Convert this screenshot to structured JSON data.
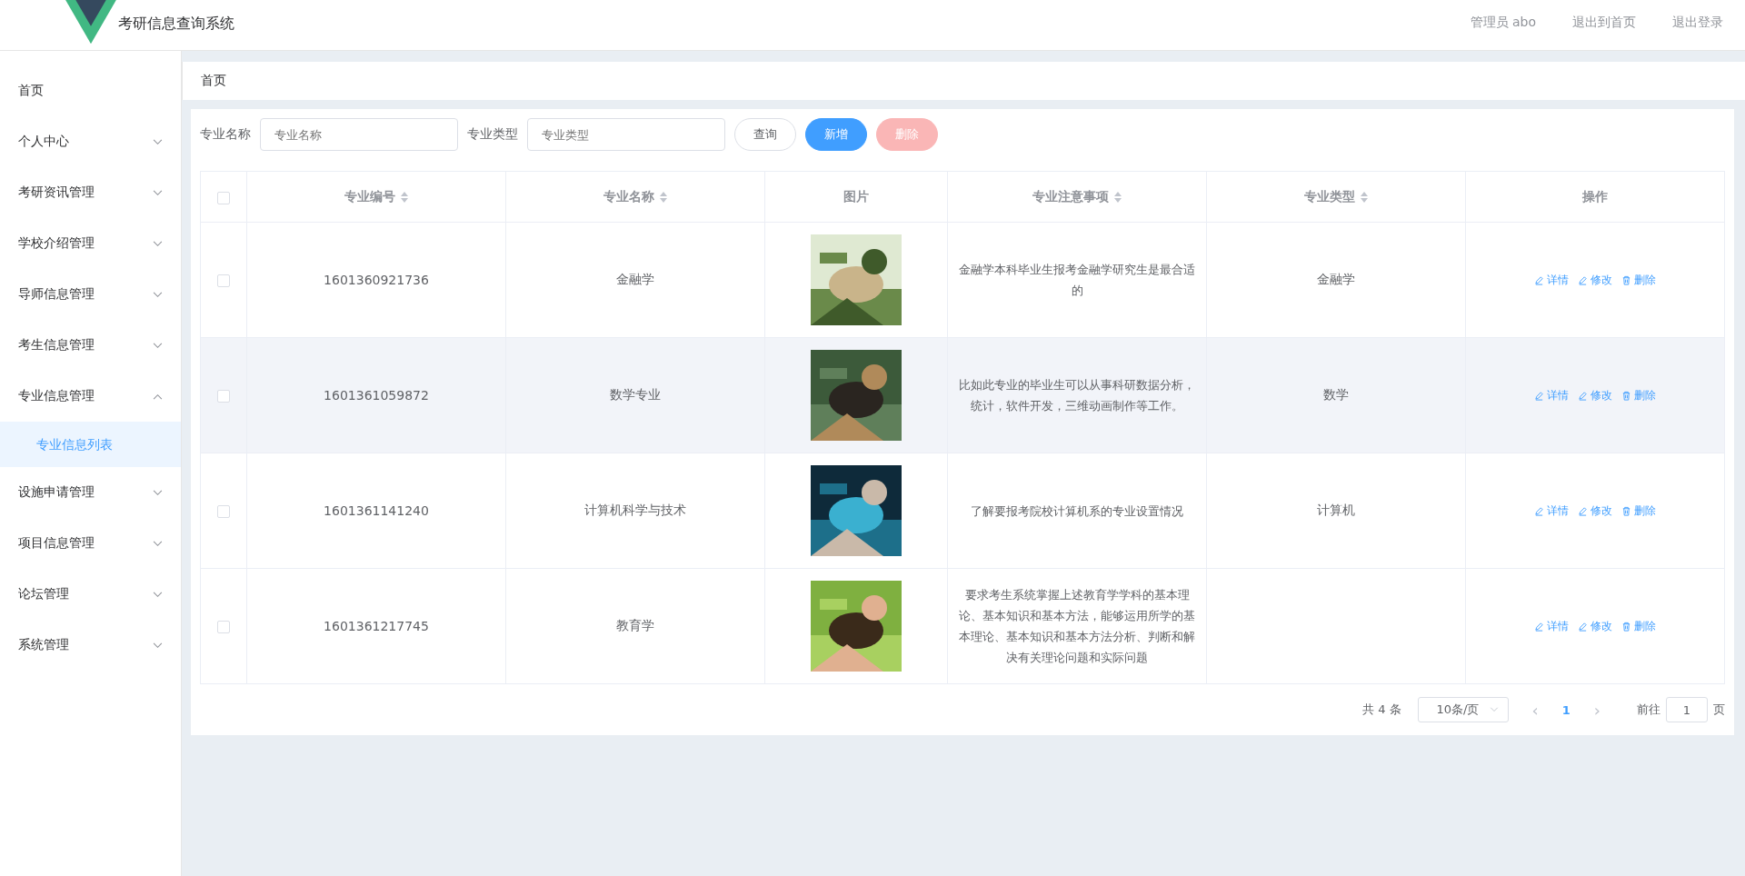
{
  "header": {
    "title": "考研信息查询系统",
    "links": [
      "管理员 abo",
      "退出到首页",
      "退出登录"
    ]
  },
  "sidebar": {
    "items": [
      {
        "label": "首页"
      },
      {
        "label": "个人中心",
        "expanded": false
      },
      {
        "label": "考研资讯管理",
        "expanded": false
      },
      {
        "label": "学校介绍管理",
        "expanded": false
      },
      {
        "label": "导师信息管理",
        "expanded": false
      },
      {
        "label": "考生信息管理",
        "expanded": false
      },
      {
        "label": "专业信息管理",
        "expanded": true,
        "children": [
          {
            "label": "专业信息列表",
            "selected": true
          }
        ]
      },
      {
        "label": "设施申请管理",
        "expanded": false
      },
      {
        "label": "项目信息管理",
        "expanded": false
      },
      {
        "label": "论坛管理",
        "expanded": false
      },
      {
        "label": "系统管理",
        "expanded": false
      }
    ]
  },
  "breadcrumb": [
    "首页"
  ],
  "search": {
    "fields": [
      {
        "label": "专业名称",
        "placeholder": "专业名称"
      },
      {
        "label": "专业类型",
        "placeholder": "专业类型"
      }
    ],
    "buttons": [
      {
        "label": "查询",
        "kind": "plain",
        "disabled": false
      },
      {
        "label": "新增",
        "kind": "primary",
        "disabled": false
      },
      {
        "label": "删除",
        "kind": "danger",
        "disabled": true
      }
    ]
  },
  "table": {
    "select_all_checked": false,
    "columns": [
      {
        "label": "专业编号",
        "sortable": true
      },
      {
        "label": "专业名称",
        "sortable": true
      },
      {
        "label": "图片",
        "sortable": false
      },
      {
        "label": "专业注意事项",
        "sortable": true
      },
      {
        "label": "专业类型",
        "sortable": true
      },
      {
        "label": "操作",
        "sortable": false
      }
    ],
    "rows": [
      {
        "checked": false,
        "highlighted": false,
        "id": "1601360921736",
        "name": "金融学",
        "image": {
          "kind": "picture"
        },
        "notes": "金融学本科毕业生报考金融学研究生是最合适的",
        "type": "金融学",
        "actions": [
          "详情",
          "修改",
          "删除"
        ]
      },
      {
        "checked": false,
        "highlighted": true,
        "id": "1601361059872",
        "name": "数学专业",
        "image": {
          "kind": "picture"
        },
        "notes": "比如此专业的毕业生可以从事科研数据分析，统计，软件开发，三维动画制作等工作。",
        "type": "数学",
        "actions": [
          "详情",
          "修改",
          "删除"
        ]
      },
      {
        "checked": false,
        "highlighted": false,
        "id": "1601361141240",
        "name": "计算机科学与技术",
        "image": {
          "kind": "picture"
        },
        "notes": "了解要报考院校计算机系的专业设置情况",
        "type": "计算机",
        "actions": [
          "详情",
          "修改",
          "删除"
        ]
      },
      {
        "checked": false,
        "highlighted": false,
        "id": "1601361217745",
        "name": "教育学",
        "image": {
          "kind": "picture"
        },
        "notes": "要求考生系统掌握上述教育学学科的基本理论、基本知识和基本方法，能够运用所学的基本理论、基本知识和基本方法分析、判断和解决有关理论问题和实际问题",
        "actions": [
          "详情",
          "修改",
          "删除"
        ]
      }
    ]
  },
  "pagination": {
    "total": "共 4 条",
    "page_size": "10条/页",
    "prev": "‹",
    "pages": [
      {
        "label": "1",
        "selected": true
      }
    ],
    "next": "›",
    "goto_label": "前往",
    "goto_value": "1",
    "goto_suffix": "页"
  }
}
